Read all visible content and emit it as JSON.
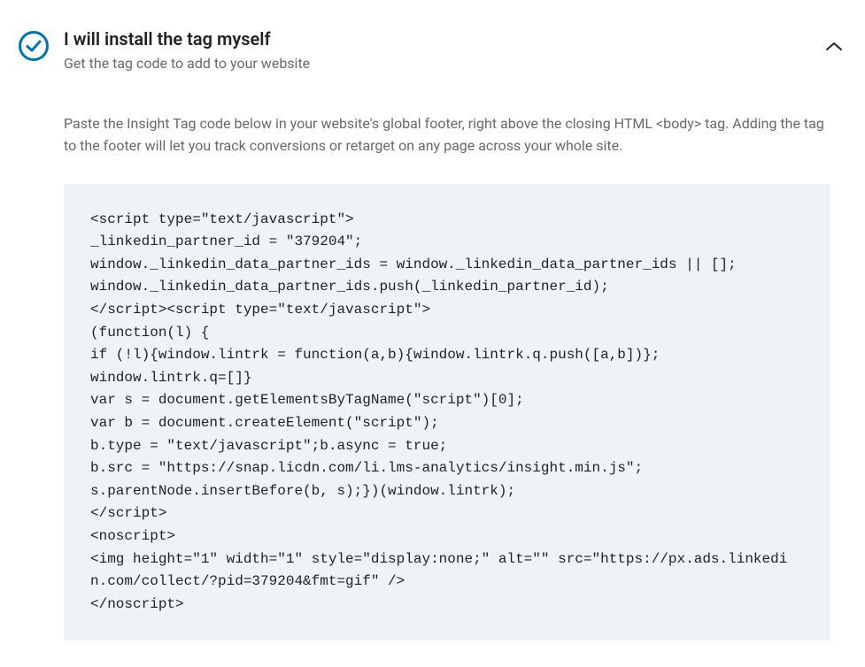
{
  "header": {
    "title": "I will install the tag myself",
    "subtitle": "Get the tag code to add to your website"
  },
  "instructions": "Paste the Insight Tag code below in your website's global footer, right above the closing HTML <body> tag. Adding the tag to the footer will let you track conversions or retarget on any page across your whole site.",
  "code_snippet": "<script type=\"text/javascript\">\n_linkedin_partner_id = \"379204\";\nwindow._linkedin_data_partner_ids = window._linkedin_data_partner_ids || [];\nwindow._linkedin_data_partner_ids.push(_linkedin_partner_id);\n</script><script type=\"text/javascript\">\n(function(l) {\nif (!l){window.lintrk = function(a,b){window.lintrk.q.push([a,b])};\nwindow.lintrk.q=[]}\nvar s = document.getElementsByTagName(\"script\")[0];\nvar b = document.createElement(\"script\");\nb.type = \"text/javascript\";b.async = true;\nb.src = \"https://snap.licdn.com/li.lms-analytics/insight.min.js\";\ns.parentNode.insertBefore(b, s);})(window.lintrk);\n</script>\n<noscript>\n<img height=\"1\" width=\"1\" style=\"display:none;\" alt=\"\" src=\"https://px.ads.linkedin.com/collect/?pid=379204&fmt=gif\" />\n</noscript>",
  "colors": {
    "accent": "#0073b1",
    "code_bg": "#eef3f8"
  }
}
